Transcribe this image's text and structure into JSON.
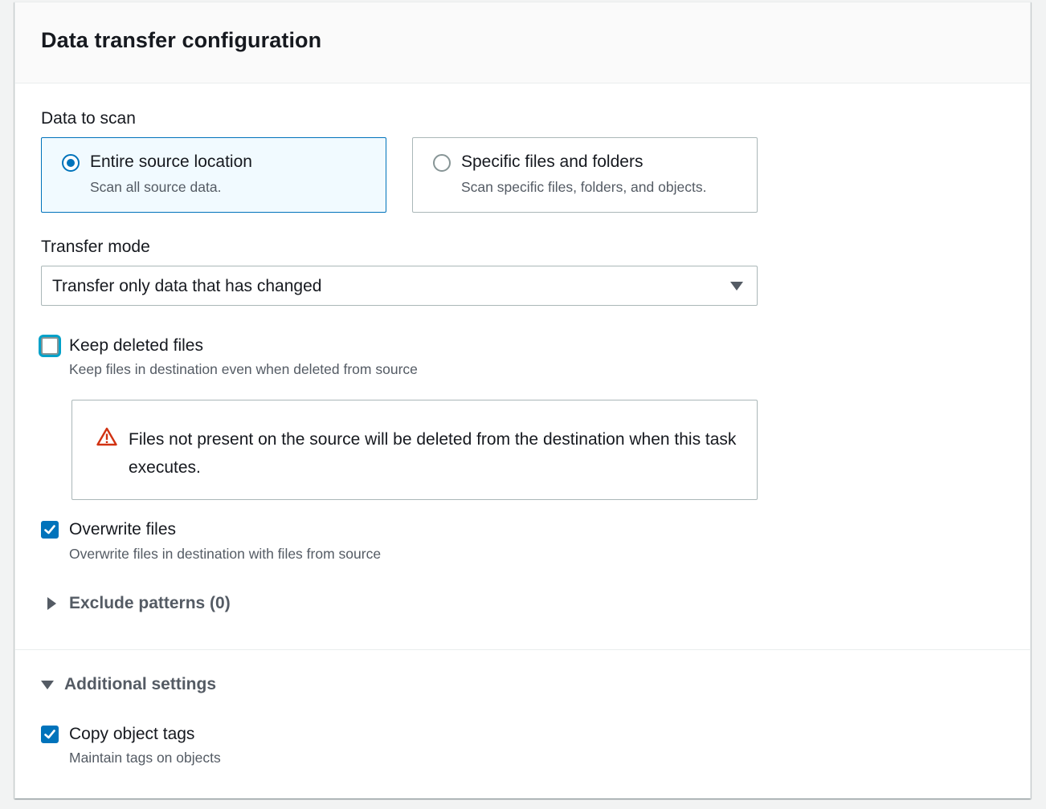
{
  "panel": {
    "title": "Data transfer configuration"
  },
  "data_to_scan": {
    "label": "Data to scan",
    "options": [
      {
        "label": "Entire source location",
        "description": "Scan all source data.",
        "selected": true
      },
      {
        "label": "Specific files and folders",
        "description": "Scan specific files, folders, and objects.",
        "selected": false
      }
    ]
  },
  "transfer_mode": {
    "label": "Transfer mode",
    "selected": "Transfer only data that has changed"
  },
  "keep_deleted": {
    "label": "Keep deleted files",
    "description": "Keep files in destination even when deleted from source",
    "checked": false
  },
  "alert": {
    "type": "warning",
    "text": "Files not present on the source will be deleted from the destination when this task executes."
  },
  "overwrite": {
    "label": "Overwrite files",
    "description": "Overwrite files in destination with files from source",
    "checked": true
  },
  "exclude_patterns": {
    "label": "Exclude patterns (0)",
    "expanded": false
  },
  "additional_settings": {
    "label": "Additional settings",
    "expanded": true
  },
  "copy_tags": {
    "label": "Copy object tags",
    "description": "Maintain tags on objects",
    "checked": true
  },
  "colors": {
    "accent": "#0073bb",
    "warning": "#d13212",
    "muted_text": "#545b64"
  }
}
